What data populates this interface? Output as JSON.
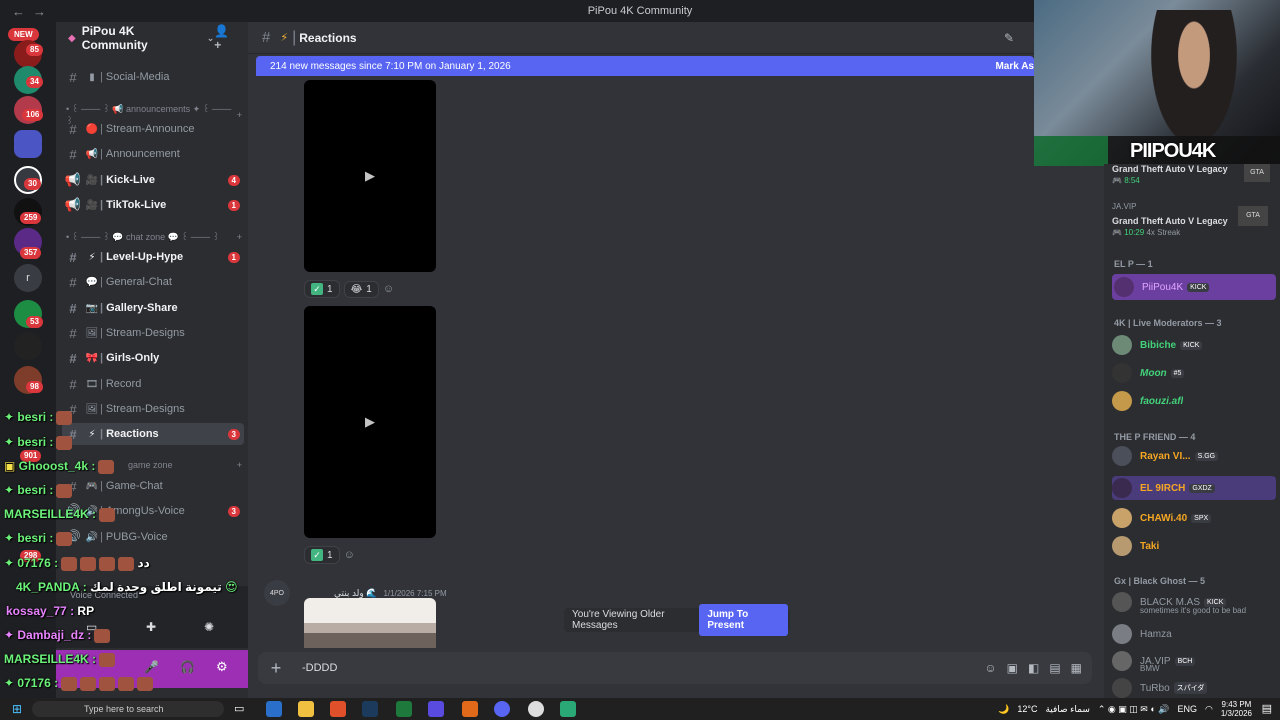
{
  "window": {
    "title": "PiPou 4K Community"
  },
  "server": {
    "name": "PiPou 4K Community"
  },
  "rail": {
    "new_label": "NEW",
    "badges": [
      "85",
      "34",
      "106",
      "30",
      "259",
      "357",
      "53",
      "98",
      "901",
      "298"
    ],
    "letter": "r"
  },
  "channels": [
    {
      "name": "Social-Media",
      "emoji": "▮"
    },
    {
      "category": "• ꒰ ─── ꒱ 📢 announcements ✦ ꒰ ─── ꒱"
    },
    {
      "name": "Stream-Announce",
      "emoji": "🔴"
    },
    {
      "name": "Announcement",
      "emoji": "📢"
    },
    {
      "name": "Kick-Live",
      "emoji": "🎥",
      "count": "4"
    },
    {
      "name": "TikTok-Live",
      "emoji": "🎥",
      "count": "1"
    },
    {
      "category": "• ꒰ ─── ꒱ 💬 chat zone 💬 ꒰ ─── ꒱"
    },
    {
      "name": "Level-Up-Hype",
      "emoji": "⚡",
      "count": "1"
    },
    {
      "name": "General-Chat",
      "emoji": "💬"
    },
    {
      "name": "Gallery-Share",
      "emoji": "📷"
    },
    {
      "name": "Stream-Designs",
      "emoji": "🖼"
    },
    {
      "name": "Girls-Only",
      "emoji": "🎀"
    },
    {
      "name": "Record",
      "emoji": "🎞"
    },
    {
      "name": "Stream-Designs",
      "emoji": "🖼"
    },
    {
      "name": "Reactions",
      "emoji": "⚡",
      "count": "3"
    },
    {
      "category": "game zone"
    },
    {
      "name": "Game-Chat",
      "emoji": "🎮"
    },
    {
      "name": "AmongUs-Voice",
      "emoji": "🔊",
      "count": "3"
    },
    {
      "name": "PUBG-Voice",
      "emoji": "🔊"
    }
  ],
  "header": {
    "channel": "Reactions"
  },
  "new_messages": {
    "text": "214 new messages since 7:10 PM on January 1, 2026",
    "mark": "Mark As"
  },
  "reactions": [
    {
      "items": [
        {
          "emoji": "✅",
          "count": "1"
        },
        {
          "emoji": "😂",
          "count": "1"
        }
      ]
    },
    {
      "items": [
        {
          "emoji": "✅",
          "count": "1"
        }
      ]
    }
  ],
  "message": {
    "avatar": "4PO",
    "author": "ولد بنتي 🌊",
    "time": "1/1/2026 7:15 PM"
  },
  "older_bar": {
    "text": "You're Viewing Older Messages",
    "button": "Jump To Present"
  },
  "composer": {
    "value": "-DDDD"
  },
  "voice": {
    "status": "Voice Connected"
  },
  "stream_chat": [
    {
      "name": "besri",
      "suffix": ":"
    },
    {
      "name": "besri",
      "suffix": ":"
    },
    {
      "name": "Ghooost_4k",
      "suffix": ":"
    },
    {
      "name": "besri",
      "suffix": ":"
    },
    {
      "name": "MARSEILLE4K",
      "suffix": ":"
    },
    {
      "name": "besri",
      "suffix": ":"
    },
    {
      "name": "07176",
      "suffix": ":",
      "text": "دد"
    },
    {
      "name": "4K_PANDA",
      "suffix": ":",
      "text": "تيمونة اطلق وحدة لمك"
    },
    {
      "name": "kossay_77",
      "suffix": ":",
      "text": "RP"
    },
    {
      "name": "Dambaji_dz",
      "suffix": ":"
    },
    {
      "name": "MARSEILLE4K",
      "suffix": ":"
    },
    {
      "name": "07176",
      "suffix": ":"
    }
  ],
  "cam": {
    "logo": "PIIPOU4K"
  },
  "members": {
    "activity1": {
      "title": "Grand Theft Auto V Legacy",
      "time": "8:54"
    },
    "activity2": {
      "user": "JA.VIP",
      "title": "Grand Theft Auto V Legacy",
      "time": "10:29",
      "streak": "4x Streak"
    },
    "groups": [
      {
        "label": "EL P — 1",
        "rows": [
          {
            "name": "PiiPou4K",
            "tag": "KICK",
            "color": "#e0a6ff"
          }
        ]
      },
      {
        "label": "4K | Live Moderators — 3",
        "rows": [
          {
            "name": "Bibiche",
            "tag": "KICK",
            "color": "#43d17a"
          },
          {
            "name": "Moon",
            "tag": "#5",
            "color": "#43d17a"
          },
          {
            "name": "faouzi.afl",
            "tag": "",
            "color": "#43d17a"
          }
        ]
      },
      {
        "label": "THE P FRIEND — 4",
        "rows": [
          {
            "name": "Rayan VI...",
            "tag": "S.GG",
            "color": "#f5a623"
          },
          {
            "name": "EL 9IRCH",
            "tag": "GXDZ",
            "color": "#f5a623"
          },
          {
            "name": "CHAWi.40",
            "tag": "SPX",
            "color": "#f5a623"
          },
          {
            "name": "Taki",
            "tag": "",
            "color": "#f5a623"
          }
        ]
      },
      {
        "label": "Gx | Black Ghost — 5",
        "rows": [
          {
            "name": "BLACK M.AS",
            "tag": "KICK",
            "color": "#949ba4",
            "sub": "sometimes it's good to be bad"
          },
          {
            "name": "Hamza",
            "tag": "",
            "color": "#949ba4"
          },
          {
            "name": "JA.VIP",
            "tag": "BCH",
            "color": "#949ba4",
            "sub": "BMW"
          },
          {
            "name": "TuRbo",
            "tag": "スパイダ",
            "color": "#949ba4"
          }
        ]
      }
    ]
  },
  "taskbar": {
    "search": "Type here to search",
    "weather": "12°C",
    "weather_text": "سماء صافية",
    "lang": "ENG",
    "time": "9:43 PM",
    "date": "1/3/2026"
  },
  "colors": {
    "accent": "#5865f2",
    "badge": "#da373c",
    "user_panel": "#9d2fb5"
  }
}
